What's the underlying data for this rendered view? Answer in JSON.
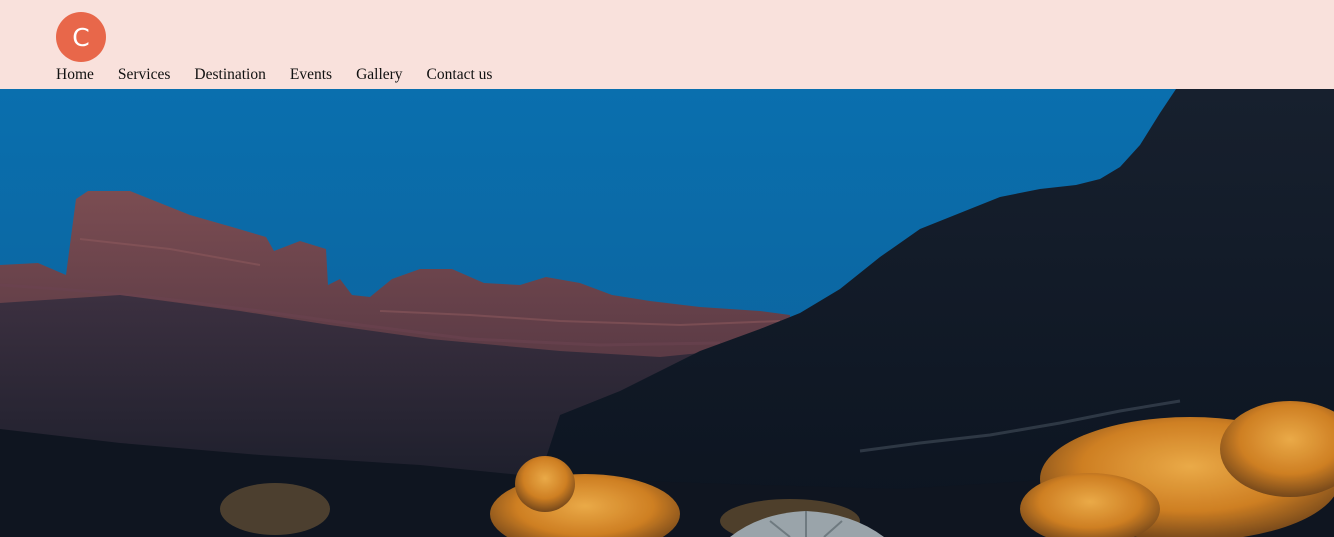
{
  "header": {
    "logo_letter": "C"
  },
  "nav": {
    "items": [
      {
        "label": "Home"
      },
      {
        "label": "Services"
      },
      {
        "label": "Destination"
      },
      {
        "label": "Events"
      },
      {
        "label": "Gallery"
      },
      {
        "label": "Contact us"
      }
    ]
  },
  "colors": {
    "header_background": "#f9e1dc",
    "logo_background": "#e8674a",
    "sky": "#0a6aa8"
  }
}
